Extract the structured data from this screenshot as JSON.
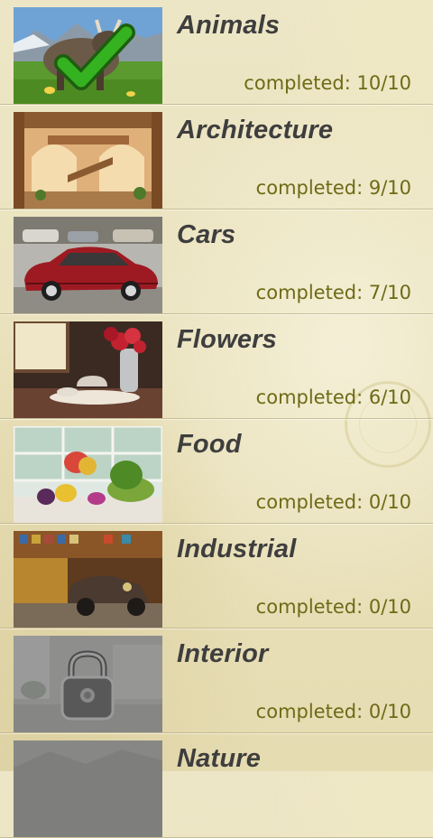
{
  "categories": [
    {
      "name": "Animals",
      "progress": "completed: 10/10",
      "state": "completed"
    },
    {
      "name": "Architecture",
      "progress": "completed: 9/10",
      "state": "unlocked"
    },
    {
      "name": "Cars",
      "progress": "completed: 7/10",
      "state": "unlocked"
    },
    {
      "name": "Flowers",
      "progress": "completed: 6/10",
      "state": "unlocked"
    },
    {
      "name": "Food",
      "progress": "completed: 0/10",
      "state": "unlocked"
    },
    {
      "name": "Industrial",
      "progress": "completed: 0/10",
      "state": "unlocked"
    },
    {
      "name": "Interior",
      "progress": "completed: 0/10",
      "state": "locked"
    },
    {
      "name": "Nature",
      "progress": "",
      "state": "locked"
    }
  ],
  "icons": {
    "completed": "checkmark-icon",
    "locked": "padlock-icon"
  },
  "colors": {
    "title": "#3e3e3e",
    "progress": "#6e6a16",
    "checkmark": "#2f9a1c",
    "background": "#ece5c3"
  }
}
